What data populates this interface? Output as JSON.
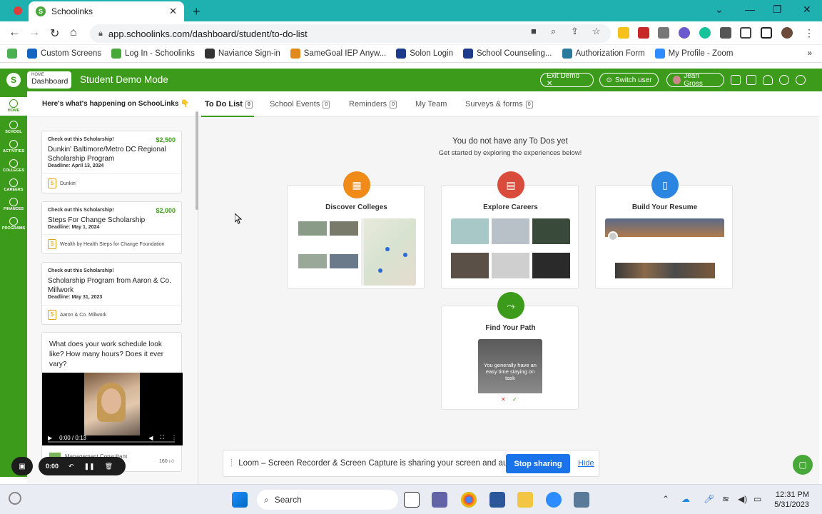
{
  "browser": {
    "tab_title": "Schoolinks",
    "tab_close": "✕",
    "new_tab": "+",
    "url": "app.schoolinks.com/dashboard/student/to-do-list"
  },
  "bookmarks": [
    {
      "label": "Custom Screens",
      "color": "#1565c0"
    },
    {
      "label": "Log In - Schoolinks",
      "color": "#48a93a"
    },
    {
      "label": "Naviance Sign-in",
      "color": "#333333"
    },
    {
      "label": "SameGoal IEP Anyw...",
      "color": "#e08a1e"
    },
    {
      "label": "Solon Login",
      "color": "#1e3a8a"
    },
    {
      "label": "School Counseling...",
      "color": "#1e3a8a"
    },
    {
      "label": "Authorization Form",
      "color": "#2a7a9c"
    },
    {
      "label": "My Profile - Zoom",
      "color": "#2d8cff"
    }
  ],
  "bookmarks_more": "»",
  "header": {
    "home_small": "HOME",
    "home_label": "Dashboard",
    "title": "Student Demo Mode",
    "exit_demo": "Exit Demo ✕",
    "switch_user": "Switch user",
    "user_name": "Jean Gross"
  },
  "rail": [
    {
      "label": "HOME",
      "active": true
    },
    {
      "label": "SCHOOL",
      "active": false
    },
    {
      "label": "ACTIVITIES",
      "active": false
    },
    {
      "label": "COLLEGES",
      "active": false
    },
    {
      "label": "CAREERS",
      "active": false
    },
    {
      "label": "FINANCES",
      "active": false
    },
    {
      "label": "PROGRAMS",
      "active": false
    }
  ],
  "side": {
    "heading": "Here's what's happening on SchooLinks 👇",
    "cards": [
      {
        "kicker": "Check out this Scholarship!",
        "amount": "$2,500",
        "title": "Dunkin' Baltimore/Metro DC Regional Scholarship Program",
        "deadline": "Deadline: April 13, 2024",
        "sponsor": "Dunkin'"
      },
      {
        "kicker": "Check out this Scholarship!",
        "amount": "$2,000",
        "title": "Steps For Change Scholarship",
        "deadline": "Deadline: May 1, 2024",
        "sponsor": "Wealth by Health Steps for Change Foundation"
      },
      {
        "kicker": "Check out this Scholarship!",
        "amount": "",
        "title": "Scholarship Program from Aaron & Co. Millwork",
        "deadline": "Deadline: May 31, 2023",
        "sponsor": "Aaron & Co. Millwork"
      }
    ],
    "video": {
      "question": "What does your work schedule look like? How many hours? Does it ever vary?",
      "time": "0:00 / 0:13",
      "author": "Management Consultant",
      "likes": "160"
    }
  },
  "recorder": {
    "time": "0:00"
  },
  "tabs": [
    {
      "label": "To Do List",
      "count": "0",
      "active": true
    },
    {
      "label": "School Events",
      "count": "0",
      "active": false
    },
    {
      "label": "Reminders",
      "count": "0",
      "active": false
    },
    {
      "label": "My Team",
      "count": "",
      "active": false
    },
    {
      "label": "Surveys & forms",
      "count": "0",
      "active": false
    }
  ],
  "main": {
    "empty_title": "You do not have any To Dos yet",
    "empty_sub": "Get started by exploring the experiences below!",
    "experiences": [
      {
        "label": "Discover Colleges",
        "color": "#f08a18",
        "icon": "college-icon"
      },
      {
        "label": "Explore Careers",
        "color": "#d94b3a",
        "icon": "briefcase-icon"
      },
      {
        "label": "Build Your Resume",
        "color": "#2a86e0",
        "icon": "document-icon"
      },
      {
        "label": "Find Your Path",
        "color": "#3c9b1a",
        "icon": "path-icon"
      }
    ],
    "path_thumb_text": "You generally have an easy time staying on task"
  },
  "loom": {
    "message": "Loom – Screen Recorder & Screen Capture is sharing your screen and audio.",
    "stop": "Stop sharing",
    "hide": "Hide"
  },
  "taskbar": {
    "search": "Search",
    "time": "12:31 PM",
    "date": "5/31/2023"
  },
  "colors": {
    "brand": "#3c9b1a",
    "chrome": "#1fb0b0",
    "accent": "#1a73e8"
  }
}
